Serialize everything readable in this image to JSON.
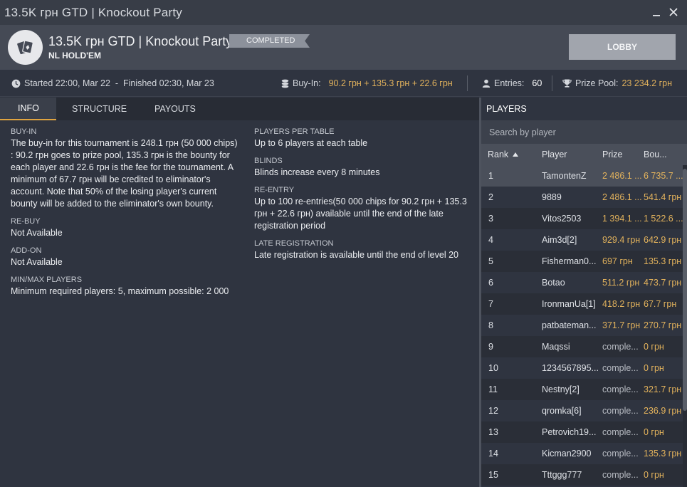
{
  "window": {
    "title": "13.5K грн GTD | Knockout Party",
    "minimize_icon": "minimize-icon",
    "close_icon": "close-icon"
  },
  "header": {
    "logo_icon": "cards-icon",
    "title": "13.5K грн GTD | Knockout Party",
    "game_type": "NL HOLD'EM",
    "status": "COMPLETED",
    "lobby_label": "LOBBY"
  },
  "infobar": {
    "time_text": "Started 22:00, Mar 22  -  Finished 02:30, Mar 23",
    "buyin_label": "Buy-In:",
    "buyin_value": "90.2 грн + 135.3 грн + 22.6 грн",
    "entries_label": "Entries:",
    "entries_value": "60",
    "prize_label": "Prize Pool:",
    "prize_value": "23 234.2 грн"
  },
  "tabs": [
    "INFO",
    "STRUCTURE",
    "PAYOUTS"
  ],
  "info": {
    "left": [
      {
        "heading": "BUY-IN",
        "text": "The buy-in for this tournament is 248.1 грн (50 000 chips) : 90.2 грн goes to prize pool, 135.3 грн is the bounty for each player and 22.6 грн is the fee for the tournament. A minimum of 67.7 грн will be credited to eliminator's account. Note that 50% of the losing player's current bounty will be added to the eliminator's own bounty."
      },
      {
        "heading": "RE-BUY",
        "text": "Not Available"
      },
      {
        "heading": "ADD-ON",
        "text": "Not Available"
      },
      {
        "heading": "MIN/MAX PLAYERS",
        "text": "Minimum required players: 5, maximum possible: 2 000"
      }
    ],
    "right": [
      {
        "heading": "PLAYERS PER TABLE",
        "text": "Up to 6 players at each table"
      },
      {
        "heading": "BLINDS",
        "text": "Blinds increase every 8 minutes"
      },
      {
        "heading": "RE-ENTRY",
        "text": "Up to 100 re-entries(50 000 chips for 90.2 грн + 135.3 грн + 22.6 грн) available until the end of the late registration period"
      },
      {
        "heading": "LATE REGISTRATION",
        "text": "Late registration is available until the end of level 20"
      }
    ]
  },
  "players": {
    "title": "PLAYERS",
    "search_placeholder": "Search by player",
    "columns": {
      "rank": "Rank",
      "player": "Player",
      "prize": "Prize",
      "bounty": "Bou..."
    },
    "sort_icon": "sort-up-icon",
    "rows": [
      {
        "rank": "1",
        "player": "TamontenZ",
        "prize": "2 486.1 ...",
        "bounty": "6 735.7 ..."
      },
      {
        "rank": "2",
        "player": "9889",
        "prize": "2 486.1 ...",
        "bounty": "541.4 грн"
      },
      {
        "rank": "3",
        "player": "Vitos2503",
        "prize": "1 394.1 ...",
        "bounty": "1 522.6 ..."
      },
      {
        "rank": "4",
        "player": "Aim3d[2]",
        "prize": "929.4 грн",
        "bounty": "642.9 грн"
      },
      {
        "rank": "5",
        "player": "Fisherman0...",
        "prize": "697 грн",
        "bounty": "135.3 грн"
      },
      {
        "rank": "6",
        "player": "Botao",
        "prize": "511.2 грн",
        "bounty": "473.7 грн"
      },
      {
        "rank": "7",
        "player": "IronmanUa[1]",
        "prize": "418.2 грн",
        "bounty": "67.7 грн"
      },
      {
        "rank": "8",
        "player": "patbateman...",
        "prize": "371.7 грн",
        "bounty": "270.7 грн"
      },
      {
        "rank": "9",
        "player": "Maqssi",
        "prize": "comple...",
        "bounty": "0 грн"
      },
      {
        "rank": "10",
        "player": "1234567895...",
        "prize": "comple...",
        "bounty": "0 грн"
      },
      {
        "rank": "11",
        "player": "Nestny[2]",
        "prize": "comple...",
        "bounty": "321.7 грн"
      },
      {
        "rank": "12",
        "player": "qromka[6]",
        "prize": "comple...",
        "bounty": "236.9 грн"
      },
      {
        "rank": "13",
        "player": "Petrovich19...",
        "prize": "comple...",
        "bounty": "0 грн"
      },
      {
        "rank": "14",
        "player": "Kicman2900",
        "prize": "comple...",
        "bounty": "135.3 грн"
      },
      {
        "rank": "15",
        "player": "Tttggg777",
        "prize": "comple...",
        "bounty": "0 грн"
      }
    ]
  },
  "colors": {
    "accent": "#e0a440",
    "gold_text": "#e2b25c",
    "background": "#2f3440"
  }
}
